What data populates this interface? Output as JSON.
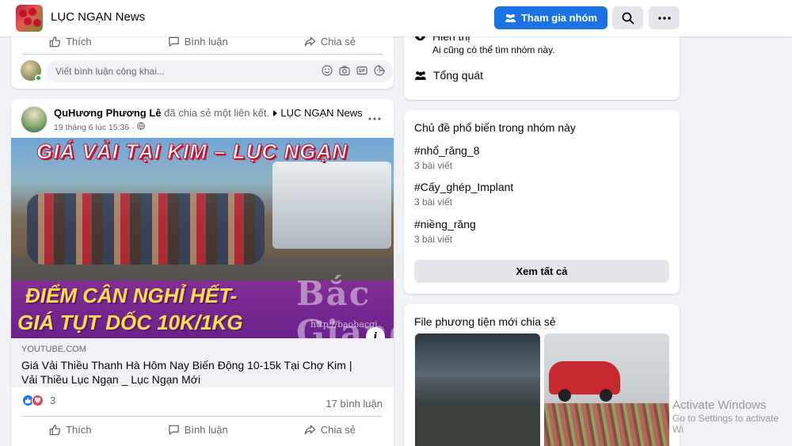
{
  "topbar": {
    "group_name": "LỤC NGẠN News",
    "join_label": "Tham gia nhóm",
    "icons": [
      "group-icon",
      "search-icon",
      "more-icon"
    ]
  },
  "prev_post": {
    "actions": {
      "like": "Thích",
      "comment": "Bình luận",
      "share": "Chia sẻ"
    },
    "comment_placeholder": "Viết bình luận công khai..."
  },
  "post": {
    "author": "QuHương Phương Lê",
    "action_text": "đã chia sẻ một liên kết.",
    "group": "LỤC NGẠN News",
    "time": "19 tháng 6 lúc 15:36 ·",
    "thumbnail": {
      "line1": "GIÁ VẢI TẠI KIM – LỤC NGẠN",
      "line2": "ĐIỂM CÂN NGHỈ HẾT-",
      "line3": "GIÁ TỤT DỐC 10K/1KG",
      "watermark": "Bắc Giang",
      "watermark_url": "http://baobacgi"
    },
    "link_domain": "YOUTUBE.COM",
    "link_title": "Giá Vải Thiều Thanh Hà Hôm Nay Biến Động 10-15k Tại Chợ Kim | Vải Thiều Lục Ngạn _ Lục Ngạn Mới",
    "reaction_count": "3",
    "comment_count": "17 bình luận",
    "actions": {
      "like": "Thích",
      "comment": "Bình luận",
      "share": "Chia sẻ"
    }
  },
  "about": {
    "visible_title": "Hiển thị",
    "visible_desc": "Ai cũng có thể tìm nhóm này.",
    "general": "Tổng quát"
  },
  "topics": {
    "title": "Chủ đề phổ biến trong nhóm này",
    "items": [
      {
        "tag": "#nhổ_răng_8",
        "count": "3 bài viết"
      },
      {
        "tag": "#Cấy_ghép_Implant",
        "count": "3 bài viết"
      },
      {
        "tag": "#niềng_răng",
        "count": "3 bài viết"
      }
    ],
    "see_all": "Xem tất cả"
  },
  "media": {
    "title": "File phương tiện mới chia sẻ"
  },
  "os_overlay": {
    "line1": "Activate Windows",
    "line2": "Go to Settings to activate Wi"
  },
  "colors": {
    "primary": "#1b74e4",
    "background": "#f0f2f5",
    "secondary_text": "#65676b"
  }
}
